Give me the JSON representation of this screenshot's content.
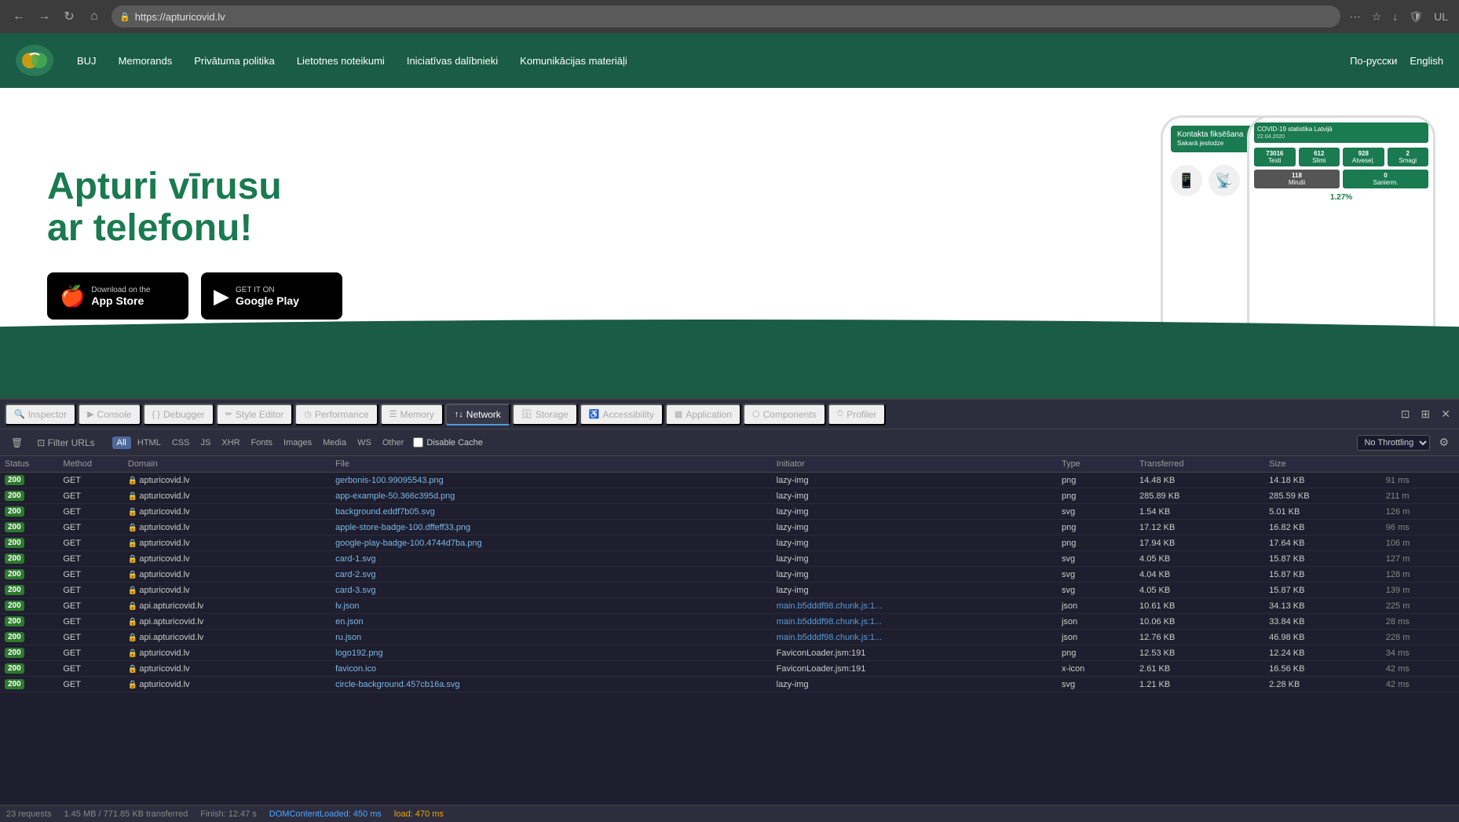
{
  "browser": {
    "url": "https://apturicovid.lv",
    "back_label": "←",
    "forward_label": "→",
    "reload_label": "↻",
    "home_label": "⌂",
    "menu_label": "⋯",
    "star_label": "☆",
    "download_label": "↓",
    "shield_label": "🛡",
    "profile_label": "UL"
  },
  "site_nav": {
    "nav_links": [
      "BUJ",
      "Memorands",
      "Privātuma politika",
      "Lietotnes noteikumi",
      "Iniciatīvas dalībnieki",
      "Komunikācijas materiāļi"
    ],
    "lang_ru": "По-русски",
    "lang_en": "English"
  },
  "hero": {
    "title_line1": "Apturi vīrusu",
    "title_line2": "ar telefonu!",
    "appstore_sub": "Download on the",
    "appstore_name": "App Store",
    "googleplay_sub": "GET IT ON",
    "googleplay_name": "Google Play"
  },
  "devtools": {
    "tabs": [
      {
        "id": "inspector",
        "label": "Inspector",
        "icon": "🔍"
      },
      {
        "id": "console",
        "label": "Console",
        "icon": "▶"
      },
      {
        "id": "debugger",
        "label": "Debugger",
        "icon": "{ }"
      },
      {
        "id": "style-editor",
        "label": "Style Editor",
        "icon": "✏"
      },
      {
        "id": "performance",
        "label": "Performance",
        "icon": "◷"
      },
      {
        "id": "memory",
        "label": "Memory",
        "icon": "☰"
      },
      {
        "id": "network",
        "label": "Network",
        "icon": "↑↓"
      },
      {
        "id": "storage",
        "label": "Storage",
        "icon": "🗄"
      },
      {
        "id": "accessibility",
        "label": "Accessibility",
        "icon": "♿"
      },
      {
        "id": "application",
        "label": "Application",
        "icon": "▦"
      },
      {
        "id": "components",
        "label": "Components",
        "icon": "⬡"
      },
      {
        "id": "profiler",
        "label": "Profiler",
        "icon": "⏱"
      }
    ],
    "active_tab": "network",
    "filter": {
      "placeholder": "Filter URLs",
      "types": [
        "All",
        "HTML",
        "CSS",
        "JS",
        "XHR",
        "Fonts",
        "Images",
        "Media",
        "WS",
        "Other"
      ],
      "active_type": "All",
      "disable_cache_label": "Disable Cache",
      "throttling_label": "No Throttling"
    },
    "table_headers": [
      "Status",
      "Method",
      "Domain",
      "File",
      "Initiator",
      "Type",
      "Transferred",
      "Size",
      ""
    ],
    "rows": [
      {
        "status": "200",
        "method": "GET",
        "domain": "apturicovid.lv",
        "file": "gerbonis-100.99095543.png",
        "initiator": "lazy-img",
        "type": "png",
        "transferred": "14.48 KB",
        "size": "14.18 KB",
        "time": "91 ms"
      },
      {
        "status": "200",
        "method": "GET",
        "domain": "apturicovid.lv",
        "file": "app-example-50.366c395d.png",
        "initiator": "lazy-img",
        "type": "png",
        "transferred": "285.89 KB",
        "size": "285.59 KB",
        "time": "211 m"
      },
      {
        "status": "200",
        "method": "GET",
        "domain": "apturicovid.lv",
        "file": "background.eddf7b05.svg",
        "initiator": "lazy-img",
        "type": "svg",
        "transferred": "1.54 KB",
        "size": "5.01 KB",
        "time": "126 m"
      },
      {
        "status": "200",
        "method": "GET",
        "domain": "apturicovid.lv",
        "file": "apple-store-badge-100.dffeff33.png",
        "initiator": "lazy-img",
        "type": "png",
        "transferred": "17.12 KB",
        "size": "16.82 KB",
        "time": "96 ms"
      },
      {
        "status": "200",
        "method": "GET",
        "domain": "apturicovid.lv",
        "file": "google-play-badge-100.4744d7ba.png",
        "initiator": "lazy-img",
        "type": "png",
        "transferred": "17.94 KB",
        "size": "17.64 KB",
        "time": "106 m"
      },
      {
        "status": "200",
        "method": "GET",
        "domain": "apturicovid.lv",
        "file": "card-1.svg",
        "initiator": "lazy-img",
        "type": "svg",
        "transferred": "4.05 KB",
        "size": "15.87 KB",
        "time": "127 m"
      },
      {
        "status": "200",
        "method": "GET",
        "domain": "apturicovid.lv",
        "file": "card-2.svg",
        "initiator": "lazy-img",
        "type": "svg",
        "transferred": "4.04 KB",
        "size": "15.87 KB",
        "time": "128 m"
      },
      {
        "status": "200",
        "method": "GET",
        "domain": "apturicovid.lv",
        "file": "card-3.svg",
        "initiator": "lazy-img",
        "type": "svg",
        "transferred": "4.05 KB",
        "size": "15.87 KB",
        "time": "139 m"
      },
      {
        "status": "200",
        "method": "GET",
        "domain": "api.apturicovid.lv",
        "file": "lv.json",
        "initiator": "main.b5dddf98.chunk.js:1...",
        "type": "json",
        "transferred": "10.61 KB",
        "size": "34.13 KB",
        "time": "225 m"
      },
      {
        "status": "200",
        "method": "GET",
        "domain": "api.apturicovid.lv",
        "file": "en.json",
        "initiator": "main.b5dddf98.chunk.js:1...",
        "type": "json",
        "transferred": "10.06 KB",
        "size": "33.84 KB",
        "time": "28 ms"
      },
      {
        "status": "200",
        "method": "GET",
        "domain": "api.apturicovid.lv",
        "file": "ru.json",
        "initiator": "main.b5dddf98.chunk.js:1...",
        "type": "json",
        "transferred": "12.76 KB",
        "size": "46.98 KB",
        "time": "228 m"
      },
      {
        "status": "200",
        "method": "GET",
        "domain": "apturicovid.lv",
        "file": "logo192.png",
        "initiator": "FaviconLoader.jsm:191",
        "type": "png",
        "transferred": "12.53 KB",
        "size": "12.24 KB",
        "time": "34 ms"
      },
      {
        "status": "200",
        "method": "GET",
        "domain": "apturicovid.lv",
        "file": "favicon.ico",
        "initiator": "FaviconLoader.jsm:191",
        "type": "x-icon",
        "transferred": "2.61 KB",
        "size": "16.56 KB",
        "time": "42 ms"
      },
      {
        "status": "200",
        "method": "GET",
        "domain": "apturicovid.lv",
        "file": "circle-background.457cb16a.svg",
        "initiator": "lazy-img",
        "type": "svg",
        "transferred": "1.21 KB",
        "size": "2.28 KB",
        "time": "42 ms"
      }
    ],
    "status_bar": {
      "requests": "23 requests",
      "transferred": "1.45 MB / 771.85 KB transferred",
      "finish": "Finish: 12.47 s",
      "domcontentloaded": "DOMContentLoaded: 450 ms",
      "load": "load: 470 ms"
    }
  }
}
